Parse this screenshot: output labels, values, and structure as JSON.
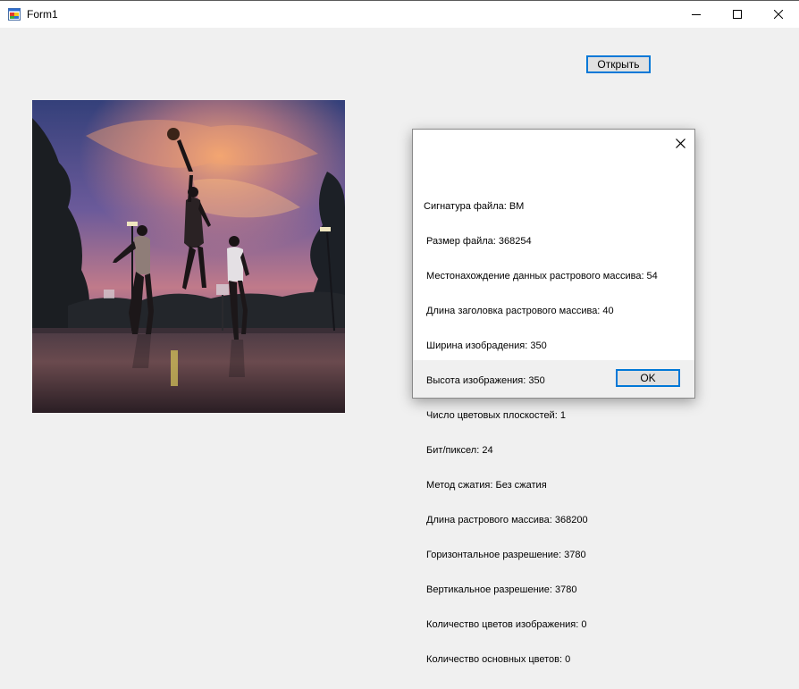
{
  "window": {
    "title": "Form1",
    "icon": "app-form-icon",
    "controls": [
      "minimize-icon",
      "maximize-icon",
      "close-icon"
    ]
  },
  "form": {
    "open_button_label": "Открыть"
  },
  "dialog": {
    "lines": [
      "Сигнатура файла: BM",
      " Размер файла: 368254",
      " Местонахождение данных растрового массива: 54",
      " Длина заголовка растрового массива: 40",
      " Ширина изобрадения: 350",
      " Высота изображения: 350",
      " Число цветовых плоскостей: 1",
      " Бит/пиксел: 24",
      " Метод сжатия: Без сжатия",
      " Длина растрового массива: 368200",
      " Горизонтальное разрешение: 3780",
      " Вертикальное разрешение: 3780",
      " Количество цветов изображения: 0",
      " Количество основных цветов: 0"
    ],
    "ok_label": "OK"
  },
  "colors": {
    "accent": "#0078d7",
    "window_bg": "#f0f0f0",
    "button_bg": "#e1e1e1"
  }
}
